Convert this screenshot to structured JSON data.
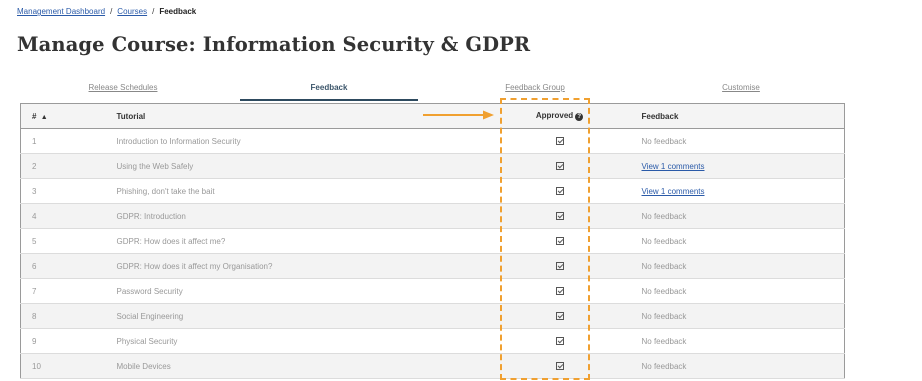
{
  "breadcrumb": {
    "items": [
      "Management Dashboard",
      "Courses"
    ],
    "separator": "/",
    "current": "Feedback"
  },
  "page": {
    "title": "Manage Course: Information Security & GDPR"
  },
  "tabs": [
    {
      "label": "Release Schedules",
      "active": false
    },
    {
      "label": "Feedback",
      "active": true
    },
    {
      "label": "Feedback Group",
      "active": false
    },
    {
      "label": "Customise",
      "active": false
    }
  ],
  "table": {
    "headers": {
      "num": "#",
      "sort_arrow": "▲",
      "tutorial": "Tutorial",
      "approved": "Approved",
      "help_icon": "?",
      "feedback": "Feedback"
    },
    "rows": [
      {
        "num": "1",
        "tutorial": "Introduction to Information Security",
        "approved": true,
        "feedback": "No feedback"
      },
      {
        "num": "2",
        "tutorial": "Using the Web Safely",
        "approved": true,
        "feedback": "View 1 comments"
      },
      {
        "num": "3",
        "tutorial": "Phishing, don't take the bait",
        "approved": true,
        "feedback": "View 1 comments"
      },
      {
        "num": "4",
        "tutorial": "GDPR: Introduction",
        "approved": true,
        "feedback": "No feedback"
      },
      {
        "num": "5",
        "tutorial": "GDPR: How does it affect me?",
        "approved": true,
        "feedback": "No feedback"
      },
      {
        "num": "6",
        "tutorial": "GDPR: How does it affect my Organisation?",
        "approved": true,
        "feedback": "No feedback"
      },
      {
        "num": "7",
        "tutorial": "Password Security",
        "approved": true,
        "feedback": "No feedback"
      },
      {
        "num": "8",
        "tutorial": "Social Engineering",
        "approved": true,
        "feedback": "No feedback"
      },
      {
        "num": "9",
        "tutorial": "Physical Security",
        "approved": true,
        "feedback": "No feedback"
      },
      {
        "num": "10",
        "tutorial": "Mobile Devices",
        "approved": true,
        "feedback": "No feedback"
      }
    ]
  },
  "colors": {
    "annotation": "#f0a030",
    "link": "#2a5aa8",
    "active_tab": "#2e4a5f"
  }
}
